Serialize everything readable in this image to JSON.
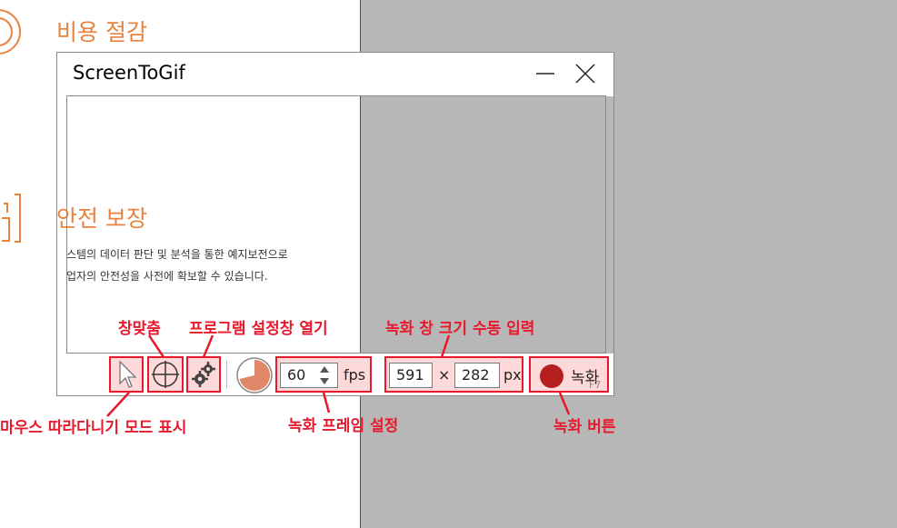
{
  "background": {
    "heading_cost": "비용 절감",
    "heading_safety": "안전 보장",
    "line1": "스템의 데이터 판단 및 분석을 통한 예지보전으로",
    "line2": "업자의 안전성을 사전에 확보할 수 있습니다."
  },
  "window": {
    "title": "ScreenToGif",
    "minimize_icon": "minimize-icon",
    "close_icon": "close-icon"
  },
  "toolbar": {
    "cursor_icon": "cursor-icon",
    "crosshair_icon": "crosshair-icon",
    "settings_icon": "gears-icon",
    "timer_icon": "timer-pie-icon",
    "fps_value": "60",
    "fps_unit": "fps",
    "width_value": "591",
    "times": "×",
    "height_value": "282",
    "size_unit": "px",
    "record_label": "녹화",
    "record_shortcut": "F7"
  },
  "annotations": {
    "snap": "창맞춤",
    "settings": "프로그램 설정창 열기",
    "size_input": "녹화 창 크기 수동 입력",
    "follow_mouse": "마우스 따라다니기 모드 표시",
    "framerate": "녹화 프레임 설정",
    "record_button": "녹화 버튼"
  },
  "colors": {
    "accent_orange": "#e8823f",
    "annotation_red": "#e8192c",
    "highlight_fill": "#ffd9d9",
    "record_dot": "#b3201f",
    "timer_fill": "#e0876a"
  }
}
